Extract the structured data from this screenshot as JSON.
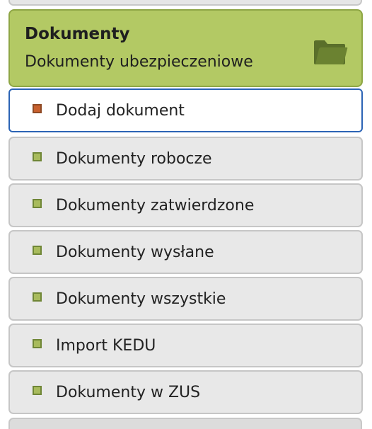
{
  "section": {
    "title": "Dokumenty",
    "subtitle": "Dokumenty ubezpieczeniowe",
    "icon": "folder-icon",
    "accent_color": "#b3c964"
  },
  "menu": {
    "active_border_color": "#2c64b5",
    "items": [
      {
        "label": "Dodaj dokument",
        "active": true
      },
      {
        "label": "Dokumenty robocze",
        "active": false
      },
      {
        "label": "Dokumenty zatwierdzone",
        "active": false
      },
      {
        "label": "Dokumenty wysłane",
        "active": false
      },
      {
        "label": "Dokumenty wszystkie",
        "active": false
      },
      {
        "label": "Import KEDU",
        "active": false
      },
      {
        "label": "Dokumenty w ZUS",
        "active": false
      }
    ]
  }
}
